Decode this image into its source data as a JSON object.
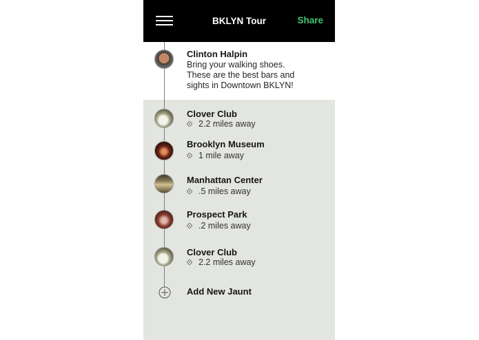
{
  "header": {
    "title": "BKLYN Tour",
    "share_label": "Share",
    "menu_icon": "hamburger-menu-icon"
  },
  "intro": {
    "author": "Clinton Halpin",
    "description": "Bring your walking shoes. These are the best bars and sights in Downtown BKLYN!"
  },
  "stops": [
    {
      "name": "Clover Club",
      "distance": "2.2 miles away"
    },
    {
      "name": "Brooklyn Museum",
      "distance": "1 mile away"
    },
    {
      "name": "Manhattan Center",
      "distance": ".5 miles away"
    },
    {
      "name": "Prospect Park",
      "distance": ".2 miles away"
    },
    {
      "name": "Clover Club",
      "distance": "2.2 miles away"
    }
  ],
  "add": {
    "label": "Add New Jaunt"
  },
  "colors": {
    "accent": "#3fc56e",
    "topbar": "#000000",
    "list_bg": "#e3e5e0"
  }
}
